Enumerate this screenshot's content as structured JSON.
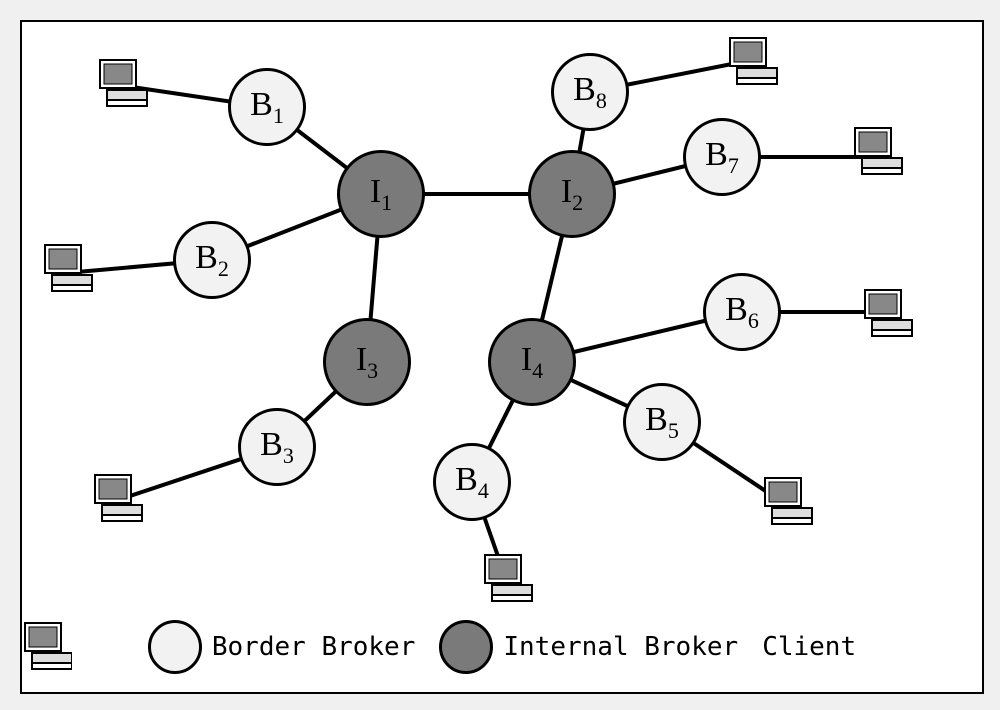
{
  "nodes": {
    "I1": {
      "label_main": "I",
      "label_sub": "1"
    },
    "I2": {
      "label_main": "I",
      "label_sub": "2"
    },
    "I3": {
      "label_main": "I",
      "label_sub": "3"
    },
    "I4": {
      "label_main": "I",
      "label_sub": "4"
    },
    "B1": {
      "label_main": "B",
      "label_sub": "1"
    },
    "B2": {
      "label_main": "B",
      "label_sub": "2"
    },
    "B3": {
      "label_main": "B",
      "label_sub": "3"
    },
    "B4": {
      "label_main": "B",
      "label_sub": "4"
    },
    "B5": {
      "label_main": "B",
      "label_sub": "5"
    },
    "B6": {
      "label_main": "B",
      "label_sub": "6"
    },
    "B7": {
      "label_main": "B",
      "label_sub": "7"
    },
    "B8": {
      "label_main": "B",
      "label_sub": "8"
    }
  },
  "legend": {
    "border": "Border Broker",
    "internal": "Internal Broker",
    "client": "Client"
  },
  "diagram": {
    "internal_brokers": [
      "I1",
      "I2",
      "I3",
      "I4"
    ],
    "border_brokers": [
      "B1",
      "B2",
      "B3",
      "B4",
      "B5",
      "B6",
      "B7",
      "B8"
    ],
    "broker_edges": [
      [
        "I1",
        "I2"
      ],
      [
        "I1",
        "I3"
      ],
      [
        "I2",
        "I4"
      ],
      [
        "B1",
        "I1"
      ],
      [
        "B2",
        "I1"
      ],
      [
        "B8",
        "I2"
      ],
      [
        "B7",
        "I2"
      ],
      [
        "B3",
        "I3"
      ],
      [
        "B4",
        "I4"
      ],
      [
        "B5",
        "I4"
      ],
      [
        "B6",
        "I4"
      ]
    ],
    "client_attachments": [
      "B1",
      "B2",
      "B3",
      "B4",
      "B5",
      "B6",
      "B7",
      "B8"
    ]
  }
}
